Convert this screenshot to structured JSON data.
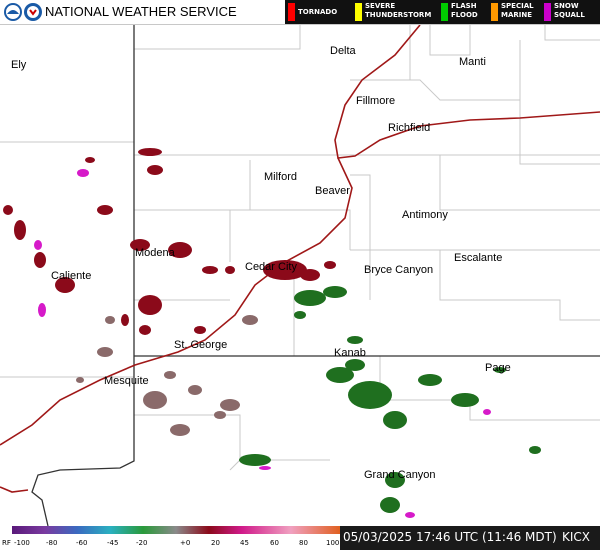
{
  "header": {
    "brand": "NATIONAL WEATHER SERVICE",
    "warnings": [
      {
        "label": "TORNADO",
        "color": "#ff0000"
      },
      {
        "label": "SEVERE\nTHUNDERSTORM",
        "color": "#ffff00"
      },
      {
        "label": "FLASH\nFLOOD",
        "color": "#00cc00"
      },
      {
        "label": "SPECIAL\nMARINE",
        "color": "#ff9900"
      },
      {
        "label": "SNOW\nSQUALL",
        "color": "#cc00cc"
      }
    ]
  },
  "cities": [
    {
      "name": "Ely"
    },
    {
      "name": "Delta"
    },
    {
      "name": "Manti"
    },
    {
      "name": "Fillmore"
    },
    {
      "name": "Richfield"
    },
    {
      "name": "Milford"
    },
    {
      "name": "Beaver"
    },
    {
      "name": "Antimony"
    },
    {
      "name": "Escalante"
    },
    {
      "name": "Bryce Canyon"
    },
    {
      "name": "Cedar City"
    },
    {
      "name": "Modena"
    },
    {
      "name": "Caliente"
    },
    {
      "name": "St. George"
    },
    {
      "name": "Kanab"
    },
    {
      "name": "Mesquite"
    },
    {
      "name": "Page"
    },
    {
      "name": "Grand Canyon"
    }
  ],
  "legend": {
    "prefix": "RF",
    "ticks": [
      "-100",
      "-80",
      "-60",
      "-45",
      "-20",
      "+0",
      "20",
      "45",
      "60",
      "80",
      "100"
    ]
  },
  "footer": {
    "timestamp": "05/03/2025 17:46 UTC (11:46 MDT)",
    "station": "KICX"
  }
}
